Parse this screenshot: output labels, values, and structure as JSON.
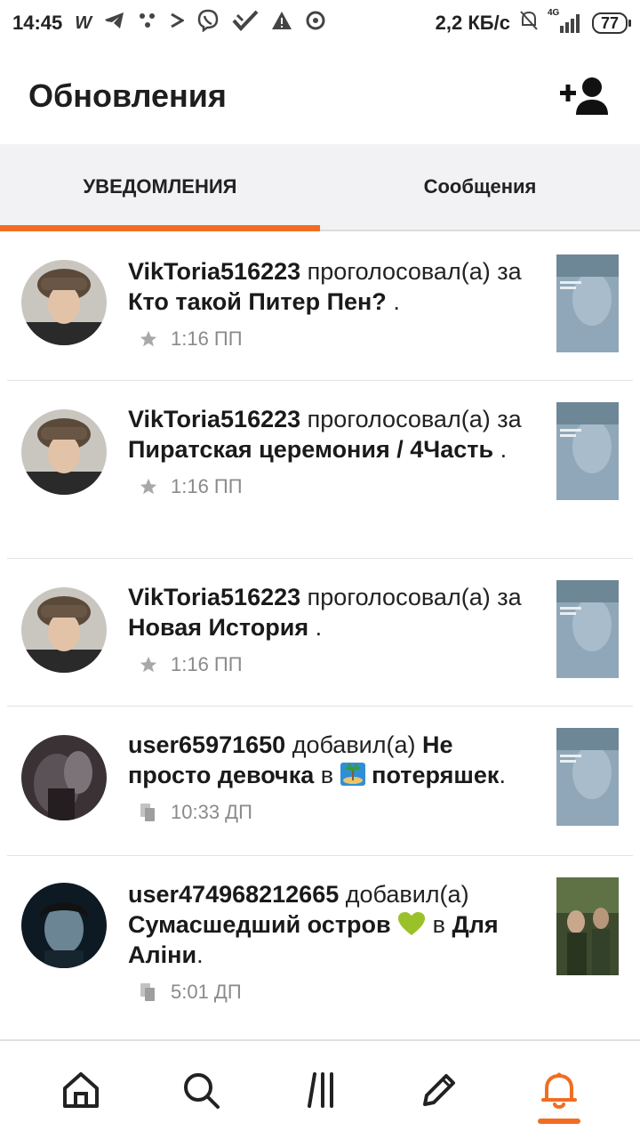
{
  "status_bar": {
    "time": "14:45",
    "icons": [
      "w-icon",
      "telegram-icon",
      "dots-icon",
      "play-icon",
      "viber-icon",
      "check-icon",
      "warning-icon",
      "disc-icon"
    ],
    "net_speed": "2,2 КБ/с",
    "network": "4G",
    "battery": "77"
  },
  "header": {
    "title": "Обновления"
  },
  "tabs": [
    {
      "label": "УВЕДОМЛЕНИЯ",
      "active": true
    },
    {
      "label": "Сообщения",
      "active": false
    }
  ],
  "notifications": [
    {
      "user": "VikToria516223",
      "action": "проголосовал(а)",
      "prep": "за",
      "target": "Кто такой Питер Пен?",
      "suffix": ".",
      "type": "vote",
      "time": "1:16 ПП"
    },
    {
      "user": "VikToria516223",
      "action": "проголосовал(а)",
      "prep": "за",
      "target": "Пиратская церемония / 4Часть",
      "suffix": ".",
      "type": "vote",
      "time": "1:16 ПП"
    },
    {
      "user": "VikToria516223",
      "action": "проголосовал(а)",
      "prep": "за",
      "target": "Новая История",
      "suffix": ".",
      "type": "vote",
      "time": "1:16 ПП"
    },
    {
      "user": "user65971650",
      "action": "добавил(а)",
      "target_a": "Не просто девочка",
      "prep_b": "в",
      "target_b": "потеряшек",
      "suffix": ".",
      "type": "add",
      "time": "10:33 ДП"
    },
    {
      "user": "user474968212665",
      "action": "добавил(а)",
      "target_a": "Сумасшедший остров",
      "prep_b": "в",
      "target_b": "Для Аліни",
      "suffix": ".",
      "type": "add",
      "time": "5:01 ДП"
    }
  ],
  "bottom_nav": [
    {
      "name": "home-icon",
      "active": false
    },
    {
      "name": "search-icon",
      "active": false
    },
    {
      "name": "library-icon",
      "active": false
    },
    {
      "name": "write-icon",
      "active": false
    },
    {
      "name": "bell-icon",
      "active": true
    }
  ],
  "colors": {
    "accent": "#f26d21",
    "tabs_bg": "#f2f1f3",
    "meta_text": "#8a8a8a"
  }
}
